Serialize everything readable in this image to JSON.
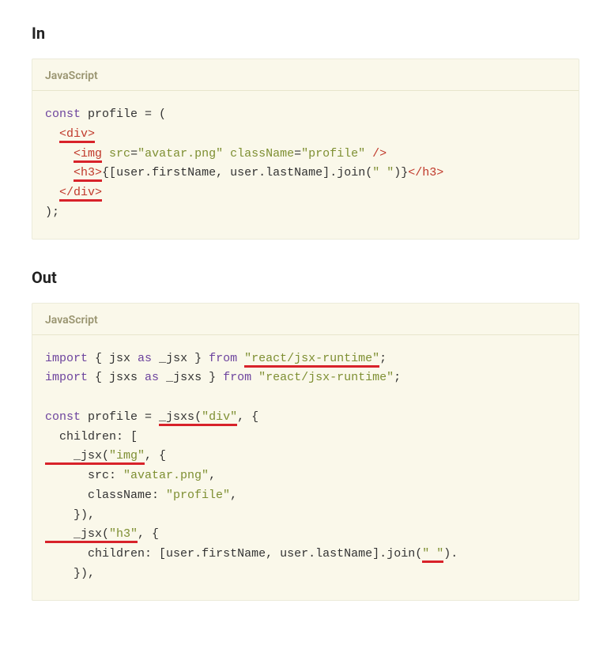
{
  "headings": {
    "in": "In",
    "out": "Out"
  },
  "codeHeader": "JavaScript",
  "inCode": {
    "l1_const": "const",
    "l1_profile": " profile ",
    "l1_eq": "=",
    "l1_open": " (",
    "l2_div": "<div>",
    "l3_imgOpen": "<img",
    "l3_src_attr": "src",
    "l3_src_val": "\"avatar.png\"",
    "l3_class_attr": "className",
    "l3_class_val": "\"profile\"",
    "l3_close": " />",
    "l4_h3Open": "<h3>",
    "l4_braceOpen": "{",
    "l4_arrOpen": "[",
    "l4_user1": "user",
    "l4_dot1": ".",
    "l4_first": "firstName",
    "l4_comma1": ", ",
    "l4_user2": "user",
    "l4_dot2": ".",
    "l4_last": "lastName",
    "l4_arrClose": "]",
    "l4_dot3": ".",
    "l4_join": "join",
    "l4_parenOpen": "(",
    "l4_space": "\" \"",
    "l4_parenClose": ")",
    "l4_braceClose": "}",
    "l4_h3Close": "</h3>",
    "l5_divClose": "</div>",
    "l6_close": ");"
  },
  "outCode": {
    "a1_import": "import",
    "a1_braceOpen": " { ",
    "a1_jsx": "jsx",
    "a1_as": " as ",
    "a1_ujsx": "_jsx",
    "a1_braceClose": " } ",
    "a1_from": "from",
    "a1_sp": " ",
    "a1_pkg": "\"react/jsx-runtime\"",
    "a1_semi": ";",
    "a2_import": "import",
    "a2_braceOpen": " { ",
    "a2_jsxs": "jsxs",
    "a2_as": " as ",
    "a2_ujsxs": "_jsxs",
    "a2_braceClose": " } ",
    "a2_from": "from",
    "a2_sp": " ",
    "a2_pkg": "\"react/jsx-runtime\"",
    "a2_semi": ";",
    "b1_const": "const",
    "b1_profile": " profile ",
    "b1_eq": "= ",
    "b1_jsxs": "_jsxs",
    "b1_paren": "(",
    "b1_div": "\"div\"",
    "b1_comma": ", {",
    "b2_children": "  children",
    "b2_colon": ": [",
    "b3_jsx": "    _jsx",
    "b3_paren": "(",
    "b3_img": "\"img\"",
    "b3_comma": ", {",
    "b4_src": "      src",
    "b4_colon": ": ",
    "b4_val": "\"avatar.png\"",
    "b4_comma": ",",
    "b5_cls": "      className",
    "b5_colon": ": ",
    "b5_val": "\"profile\"",
    "b5_comma": ",",
    "b6_close": "    }),",
    "b7_jsx": "    _jsx",
    "b7_paren": "(",
    "b7_h3": "\"h3\"",
    "b7_comma": ", {",
    "b8_children": "      children",
    "b8_colon": ": [",
    "b8_user1": "user",
    "b8_dot1": ".",
    "b8_first": "firstName",
    "b8_comma1": ", ",
    "b8_user2": "user",
    "b8_dot2": ".",
    "b8_last": "lastName",
    "b8_arrClose": "]",
    "b8_dot3": ".",
    "b8_join": "join",
    "b8_parenOpen": "(",
    "b8_space": "\" \"",
    "b8_parenClose": ")",
    "b8_trail": ".",
    "b9_close": "    }),"
  }
}
